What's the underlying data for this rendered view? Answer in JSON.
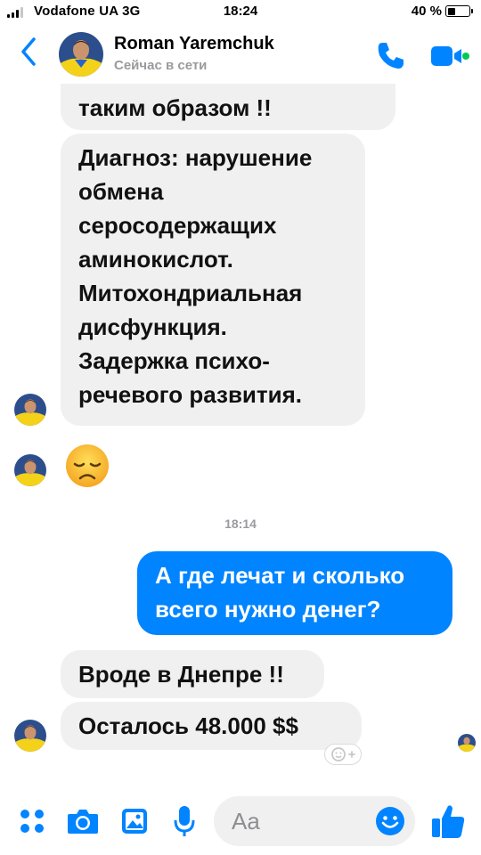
{
  "status_bar": {
    "carrier": "Vodafone UA 3G",
    "time": "18:24",
    "battery_percent": "40 %",
    "battery_level": 0.4
  },
  "header": {
    "contact_name": "Roman Yaremchuk",
    "contact_status": "Сейчас в сети",
    "accent_color": "#0084ff"
  },
  "messages": [
    {
      "direction": "in",
      "text": "таким образом !!"
    },
    {
      "direction": "in",
      "lines": [
        "Диагноз: нарушение",
        "обмена",
        "серосодержащих",
        "аминокислот.",
        "Митохондриальная",
        "дисфункция.",
        "Задержка психо-",
        "речевого развития."
      ]
    },
    {
      "direction": "in",
      "emoji": "disappointed-face"
    },
    {
      "timestamp": "18:14"
    },
    {
      "direction": "out",
      "lines": [
        "А где лечат и сколько",
        "всего нужно денег?"
      ]
    },
    {
      "direction": "in",
      "text": "Вроде в Днепре !!"
    },
    {
      "direction": "in",
      "text": "Осталось 48.000 $$"
    }
  ],
  "composer": {
    "placeholder": "Aa",
    "icons": [
      "grid-icon",
      "camera-icon",
      "image-icon",
      "microphone-icon",
      "emoji-icon",
      "thumbs-up-icon"
    ]
  }
}
